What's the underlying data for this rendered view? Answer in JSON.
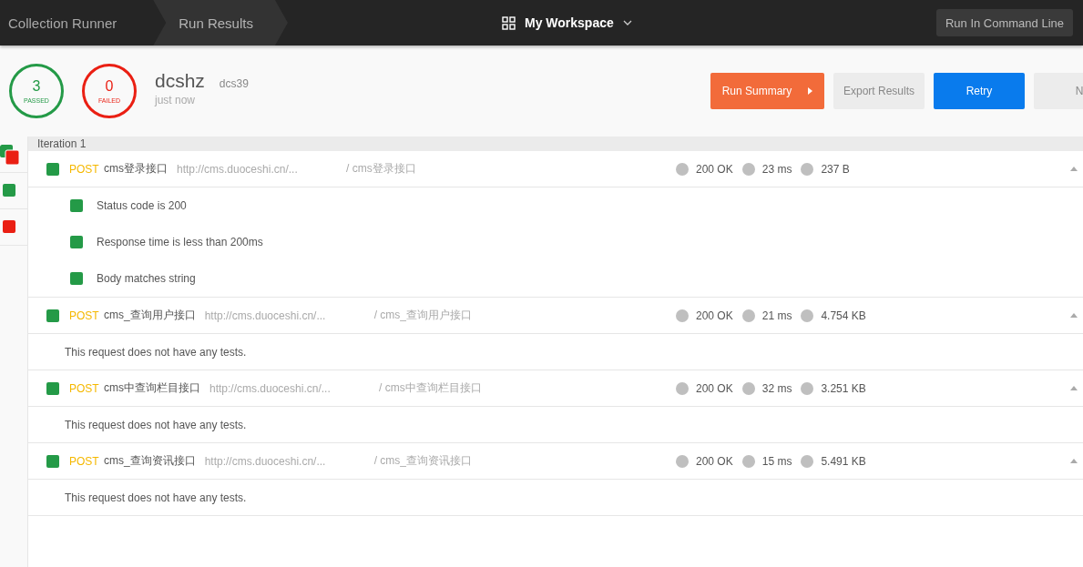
{
  "header": {
    "breadcrumbs": [
      {
        "label": "Collection Runner",
        "selected": false
      },
      {
        "label": "Run Results",
        "selected": true
      }
    ],
    "workspace": "My Workspace",
    "command_button": "Run In Command Line"
  },
  "summary": {
    "passed": {
      "count": "3",
      "label": "PASSED"
    },
    "failed": {
      "count": "0",
      "label": "FAILED"
    },
    "collection": "dcshz",
    "environment": "dcs39",
    "time": "just now",
    "buttons": [
      {
        "label": "Run Summary",
        "kind": "primary"
      },
      {
        "label": "Export Results",
        "kind": "secondary"
      },
      {
        "label": "Retry",
        "kind": "accent"
      },
      {
        "label": "N",
        "kind": "secondary"
      }
    ]
  },
  "sidebar": [
    {
      "kind": "mixed"
    },
    {
      "kind": "pass"
    },
    {
      "kind": "fail"
    }
  ],
  "iteration": "Iteration 1",
  "requests": [
    {
      "passed": true,
      "method": "POST",
      "name": "cms登录接口",
      "url": "http://cms.duoceshi.cn/...",
      "path": "/ cms登录接口",
      "status": "200 OK",
      "time": "23 ms",
      "size": "237 B",
      "expanded": true,
      "tests": [
        {
          "name": "Status code is 200",
          "passed": true
        },
        {
          "name": "Response time is less than 200ms",
          "passed": true
        },
        {
          "name": "Body matches string",
          "passed": true
        }
      ]
    },
    {
      "passed": true,
      "method": "POST",
      "name": "cms_查询用户接口",
      "url": "http://cms.duoceshi.cn/...",
      "path": "/ cms_查询用户接口",
      "status": "200 OK",
      "time": "21 ms",
      "size": "4.754 KB",
      "expanded": true,
      "no_tests": "This request does not have any tests."
    },
    {
      "passed": true,
      "method": "POST",
      "name": "cms中查询栏目接口",
      "url": "http://cms.duoceshi.cn/...",
      "path": "/ cms中查询栏目接口",
      "status": "200 OK",
      "time": "32 ms",
      "size": "3.251 KB",
      "expanded": true,
      "no_tests": "This request does not have any tests."
    },
    {
      "passed": true,
      "method": "POST",
      "name": "cms_查询资讯接口",
      "url": "http://cms.duoceshi.cn/...",
      "path": "/ cms_查询资讯接口",
      "status": "200 OK",
      "time": "15 ms",
      "size": "5.491 KB",
      "expanded": true,
      "no_tests": "This request does not have any tests."
    }
  ]
}
